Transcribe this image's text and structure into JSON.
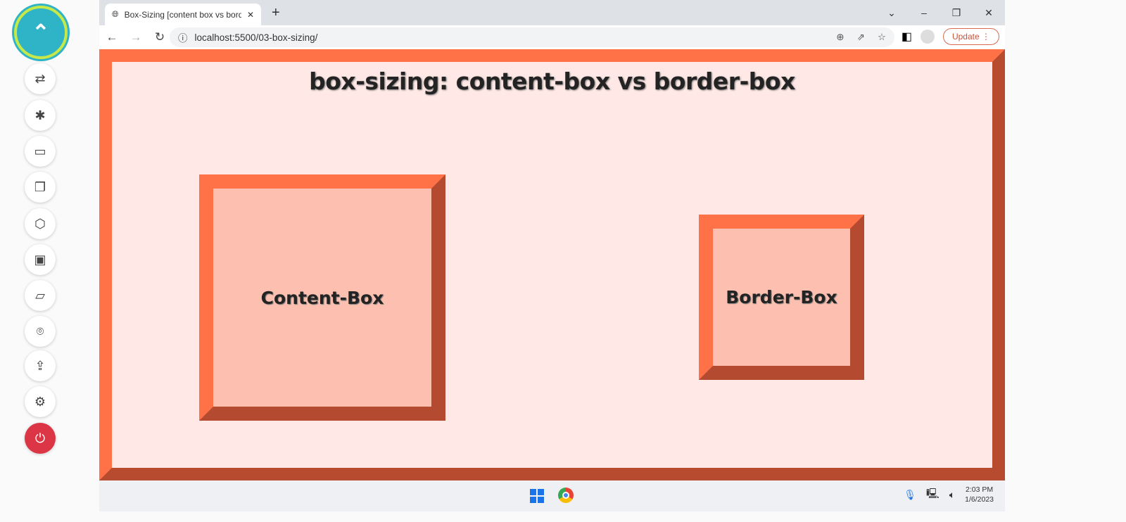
{
  "sidebar": {
    "items": [
      "collapse",
      "connect",
      "debug",
      "record",
      "pages",
      "3d",
      "present",
      "folder",
      "location",
      "upload",
      "settings",
      "power"
    ]
  },
  "browser": {
    "tab_title": "Box-Sizing [content box vs border-box]",
    "url": "localhost:5500/03-box-sizing/",
    "update_label": "Update"
  },
  "page": {
    "title": "box-sizing: content-box vs border-box",
    "content_box_label": "Content-Box",
    "border_box_label": "Border-Box"
  },
  "taskbar": {
    "time": "2:03 PM",
    "date": "1/6/2023"
  },
  "colors": {
    "border_light": "#ff7146",
    "border_dark": "#b64b30",
    "page_bg": "#ffe8e5",
    "box_bg": "#fcbfb0"
  }
}
